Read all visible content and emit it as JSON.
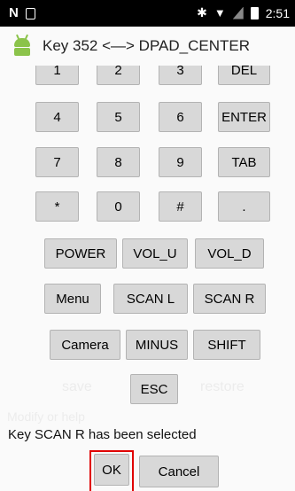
{
  "status_bar": {
    "left_icons": [
      "notification-n-icon",
      "image-icon"
    ],
    "right_icons": [
      "bluetooth-icon",
      "wifi-icon",
      "sim-icon",
      "battery-icon"
    ],
    "time": "2:51"
  },
  "dialog": {
    "title": "Key 352 <—> DPAD_CENTER",
    "keys": {
      "row0": [
        "1",
        "2",
        "3",
        "DEL"
      ],
      "row1": [
        "4",
        "5",
        "6",
        "ENTER"
      ],
      "row2": [
        "7",
        "8",
        "9",
        "TAB"
      ],
      "row3": [
        "*",
        "0",
        "#",
        "."
      ],
      "row4": [
        "POWER",
        "VOL_U",
        "VOL_D"
      ],
      "row5": [
        "Menu",
        "SCAN L",
        "SCAN R"
      ],
      "row6": [
        "Camera",
        "MINUS",
        "SHIFT"
      ],
      "row7": [
        "ESC"
      ]
    },
    "background_labels": {
      "save": "save",
      "restore": "restore",
      "modify_hint": "Modify or help"
    },
    "selected_message": "Key SCAN R has been selected",
    "ok_label": "OK",
    "cancel_label": "Cancel"
  },
  "colors": {
    "highlight": "#e00000",
    "button_bg": "#d8d8d8"
  }
}
